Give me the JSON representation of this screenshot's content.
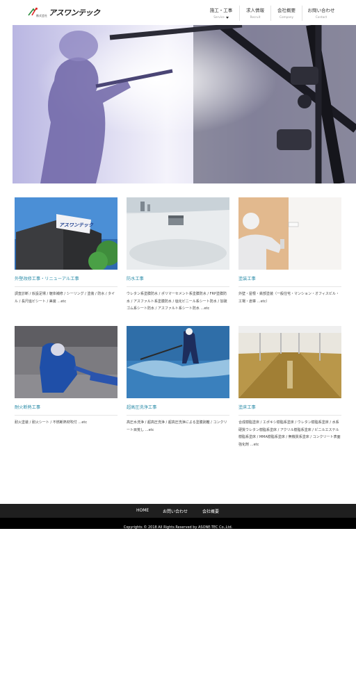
{
  "header": {
    "logo_sub": "株式会社",
    "logo_text": "アスワンテック",
    "nav": [
      {
        "label": "施工・工事",
        "sub": "Service"
      },
      {
        "label": "求人情報",
        "sub": "Recruit"
      },
      {
        "label": "会社概要",
        "sub": "Company"
      },
      {
        "label": "お問い合わせ",
        "sub": "Contact"
      }
    ]
  },
  "services": [
    {
      "title": "外壁改修工事・リニューアル工事",
      "desc": "調査診断 / 仮設足場 / 躯体補修 / シーリング / 塗装 / 防水 / タイル / 長尺塩ビシート / 美装 …etc"
    },
    {
      "title": "防水工事",
      "desc": "ウレタン系塗膜防水 / ポリマーセメント系塗膜防水 / FRP塗膜防水 / アスファルト系塗膜防水 / 塩化ビニール系シート防水 / 加硫ゴム系シート防水 / アスファルト系シート防水 …etc"
    },
    {
      "title": "塗装工事",
      "desc": "外壁・屋根・鉄部塗装（一般住宅・マンション・オフィスビル・工場・倉庫 …etc）"
    },
    {
      "title": "耐火断熱工事",
      "desc": "耐火塗装 / 耐火シート / 不燃断熱材吹付 …etc"
    },
    {
      "title": "超高圧洗浄工事",
      "desc": "高圧水洗浄 / 超高圧洗浄 / 超高圧洗浄による塗膜剥離 / コンクリート目荒し …etc"
    },
    {
      "title": "塗床工事",
      "desc": "合成樹脂塗床 / エポキシ樹脂系塗床 / ウレタン樹脂系塗床 / 水系硬質ウレタン樹脂系塗床 / アクリル樹脂系塗床 / ビニルエステル樹脂系塗床 / MMA樹脂系塗床 / 無機質系塗床 / コンクリート表面強化剤 …etc"
    }
  ],
  "banner_text": "アスワンテック",
  "footer": {
    "links": [
      "HOME",
      "お問い合わせ",
      "会社概要"
    ],
    "copyright": "Copyrights © 2018 All Rights Reserved by ASONE-TEC Co.,Ltd."
  }
}
